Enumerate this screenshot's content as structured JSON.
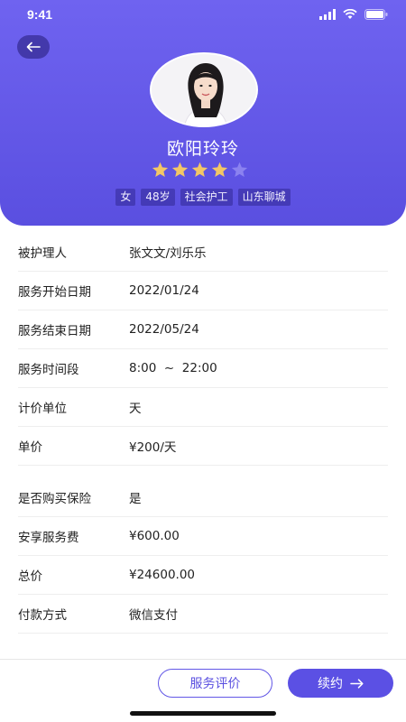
{
  "status": {
    "time": "9:41"
  },
  "profile": {
    "name": "欧阳玲玲",
    "rating": 4,
    "max_rating": 5,
    "tags": [
      "女",
      "48岁",
      "社会护工",
      "山东聊城"
    ]
  },
  "details": [
    {
      "label": "被护理人",
      "value": "张文文/刘乐乐"
    },
    {
      "label": "服务开始日期",
      "value": "2022/01/24"
    },
    {
      "label": "服务结束日期",
      "value": "2022/05/24"
    },
    {
      "label": "服务时间段",
      "value": "8:00  ~  22:00"
    },
    {
      "label": "计价单位",
      "value": "天"
    },
    {
      "label": "单价",
      "value": "¥200/天"
    },
    {
      "label": "是否购买保险",
      "value": "是"
    },
    {
      "label": "安享服务费",
      "value": "¥600.00"
    },
    {
      "label": "总价",
      "value": "¥24600.00"
    },
    {
      "label": "付款方式",
      "value": "微信支付"
    }
  ],
  "actions": {
    "review_label": "服务评价",
    "renew_label": "续约"
  },
  "colors": {
    "accent": "#5b50e4",
    "star_filled": "#f3c766",
    "star_empty": "#8b82f0"
  },
  "icons": {
    "back": "arrow-left-icon",
    "renew": "arrow-right-icon",
    "signal": "signal-icon",
    "wifi": "wifi-icon",
    "battery": "battery-icon"
  }
}
